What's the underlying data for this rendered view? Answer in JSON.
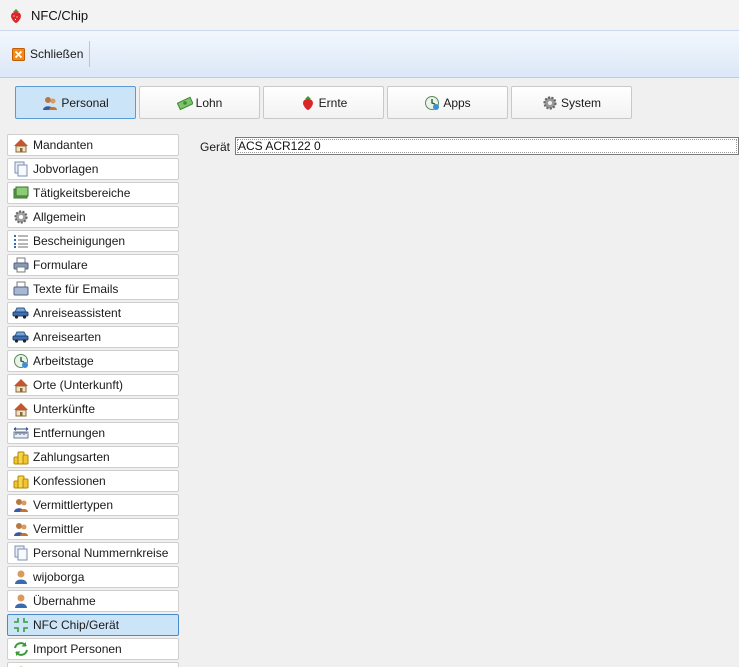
{
  "window": {
    "title": "NFC/Chip"
  },
  "toolbar": {
    "close_label": "Schließen"
  },
  "modules": [
    {
      "label": "Personal",
      "icon": "people-icon",
      "active": true
    },
    {
      "label": "Lohn",
      "icon": "money-icon",
      "active": false
    },
    {
      "label": "Ernte",
      "icon": "strawberry-icon",
      "active": false
    },
    {
      "label": "Apps",
      "icon": "clock-icon",
      "active": false
    },
    {
      "label": "System",
      "icon": "gear-icon",
      "active": false
    }
  ],
  "sidebar": {
    "items": [
      {
        "label": "Mandanten",
        "icon": "house-icon"
      },
      {
        "label": "Jobvorlagen",
        "icon": "copy-icon"
      },
      {
        "label": "Tätigkeitsbereiche",
        "icon": "cash-icon"
      },
      {
        "label": "Allgemein",
        "icon": "gear-icon"
      },
      {
        "label": "Bescheinigungen",
        "icon": "list-icon"
      },
      {
        "label": "Formulare",
        "icon": "printer-icon"
      },
      {
        "label": "Texte für Emails",
        "icon": "mail-icon"
      },
      {
        "label": "Anreiseassistent",
        "icon": "car-icon"
      },
      {
        "label": "Anreisearten",
        "icon": "car-icon"
      },
      {
        "label": "Arbeitstage",
        "icon": "clock-icon"
      },
      {
        "label": "Orte (Unterkunft)",
        "icon": "house-icon"
      },
      {
        "label": "Unterkünfte",
        "icon": "house-icon"
      },
      {
        "label": "Entfernungen",
        "icon": "ruler-icon"
      },
      {
        "label": "Zahlungsarten",
        "icon": "coins-icon"
      },
      {
        "label": "Konfessionen",
        "icon": "coins-icon"
      },
      {
        "label": "Vermittlertypen",
        "icon": "people-icon"
      },
      {
        "label": "Vermittler",
        "icon": "people-icon"
      },
      {
        "label": "Personal Nummernkreise",
        "icon": "copy-icon"
      },
      {
        "label": "wijoborga",
        "icon": "user-icon"
      },
      {
        "label": "Übernahme",
        "icon": "user-icon"
      },
      {
        "label": "NFC Chip/Gerät",
        "icon": "nfc-icon",
        "active": true
      },
      {
        "label": "Import Personen",
        "icon": "refresh-icon"
      },
      {
        "label": "",
        "icon": "user-icon"
      }
    ]
  },
  "form": {
    "device_label": "Gerät",
    "device_value": "ACS ACR122 0"
  },
  "colors": {
    "accent": "#cce4f7",
    "accent_border": "#5a9bd5",
    "toolbar_bg": "#dbe7f7"
  }
}
